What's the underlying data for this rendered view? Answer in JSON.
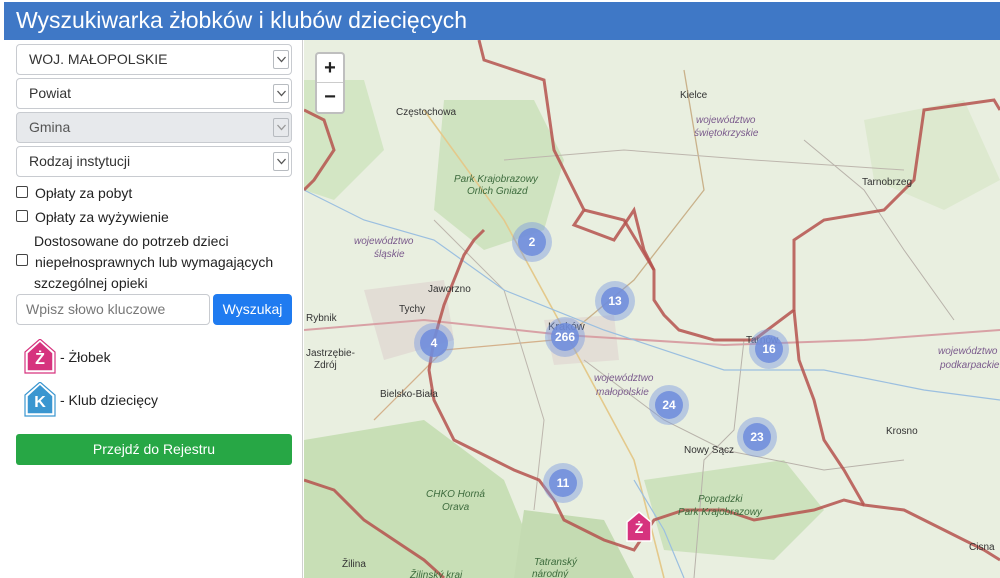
{
  "header": {
    "title": "Wyszukiwarka żłobków i klubów dziecięcych"
  },
  "filters": {
    "voivodeship": "WOJ. MAŁOPOLSKIE",
    "county": "Powiat",
    "commune": "Gmina",
    "institution_type": "Rodzaj instytucji"
  },
  "checkboxes": {
    "stay_fees": "Opłaty za pobyt",
    "meal_fees": "Opłaty za wyżywienie",
    "disabled_line1": "Dostosowane do potrzeb dzieci",
    "disabled_line2": "niepełnosprawnych lub wymagających",
    "disabled_line3": "szczególnej opieki"
  },
  "search": {
    "placeholder": "Wpisz słowo kluczowe",
    "button": "Wyszukaj"
  },
  "legend": {
    "nursery_letter": "Ż",
    "nursery_label": "- Żłobek",
    "club_letter": "K",
    "club_label": "- Klub dziecięcy"
  },
  "registry_button": "Przejdź do Rejestru",
  "map": {
    "zoom_in": "+",
    "zoom_out": "−",
    "clusters": [
      "2",
      "13",
      "266",
      "4",
      "16",
      "24",
      "23",
      "11"
    ],
    "marker_letter": "Ż",
    "labels": {
      "czestochowa": "Częstochowa",
      "kielce": "Kielce",
      "swietokrzyskie_1": "województwo",
      "swietokrzyskie_2": "świętokrzyskie",
      "park_orle_1": "Park Krajobrazowy",
      "park_orle_2": "Orlich Gniazd",
      "tarnobrzeg": "Tarnobrzeg",
      "slaskie_1": "województwo",
      "slaskie_2": "śląskie",
      "jaworzno": "Jaworzno",
      "tychy": "Tychy",
      "rybnik": "Rybnik",
      "krakow": "Kraków",
      "jastrzebie_1": "Jastrzębie-",
      "jastrzebie_2": "Zdrój",
      "tarnow": "Tarnów",
      "podkarpackie_1": "województwo",
      "podkarpackie_2": "podkarpackie",
      "malopolskie_1": "województwo",
      "malopolskie_2": "małopolskie",
      "bielsko": "Bielsko-Biała",
      "nowy_sacz": "Nowy Sącz",
      "krosno": "Krosno",
      "cho_1": "CHKO Horná",
      "cho_2": "Orava",
      "popradzki_1": "Popradzki",
      "popradzki_2": "Park Krajobrazowy",
      "zilina": "Žilina",
      "cisna": "Cisna",
      "tatransky_1": "Tatranský",
      "tatransky_2": "národný",
      "zilinsky": "Žilinský kraj"
    }
  },
  "colors": {
    "header": "#3f78c6",
    "search_button": "#1f7bf0",
    "registry_button": "#27a745",
    "nursery_icon": "#d6337e",
    "club_icon": "#3a96d0",
    "border": "#b5524e"
  }
}
